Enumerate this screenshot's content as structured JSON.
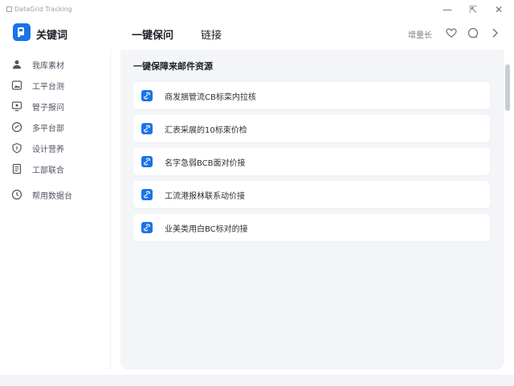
{
  "titlebar": {
    "title": "DataGrid Tracking",
    "controls": {
      "minimize": "—",
      "restore": "⇱",
      "close": "✕"
    }
  },
  "header": {
    "app_title": "关键词",
    "tabs": [
      {
        "label": "一键保问",
        "active": true
      },
      {
        "label": "链接",
        "active": false
      }
    ],
    "link_label": "增量长",
    "icons": [
      "heart-icon",
      "chat-bubble-icon",
      "chevron-right-icon"
    ]
  },
  "sidebar": {
    "items": [
      {
        "label": "我库素材",
        "icon": "user-icon"
      },
      {
        "label": "工平台测",
        "icon": "image-icon"
      },
      {
        "label": "管子报问",
        "icon": "monitor-icon"
      },
      {
        "label": "多平台部",
        "icon": "speed-icon"
      },
      {
        "label": "设计营养",
        "icon": "shield-icon"
      },
      {
        "label": "工部联合",
        "icon": "document-icon"
      },
      {
        "label": "帮用数据台",
        "icon": "clock-icon"
      }
    ]
  },
  "main": {
    "section_title": "一键保障来邮件资源",
    "cards": [
      {
        "label": "商发捆管流CB标栾内拉核"
      },
      {
        "label": "汇表采展的10标束价检"
      },
      {
        "label": "名字急弱BCB面对价接"
      },
      {
        "label": "工流港报林联系动价接"
      },
      {
        "label": "业美类用白BC标对的接"
      }
    ]
  },
  "colors": {
    "accent": "#1a73e8",
    "panel_bg": "#f4f5f8"
  }
}
